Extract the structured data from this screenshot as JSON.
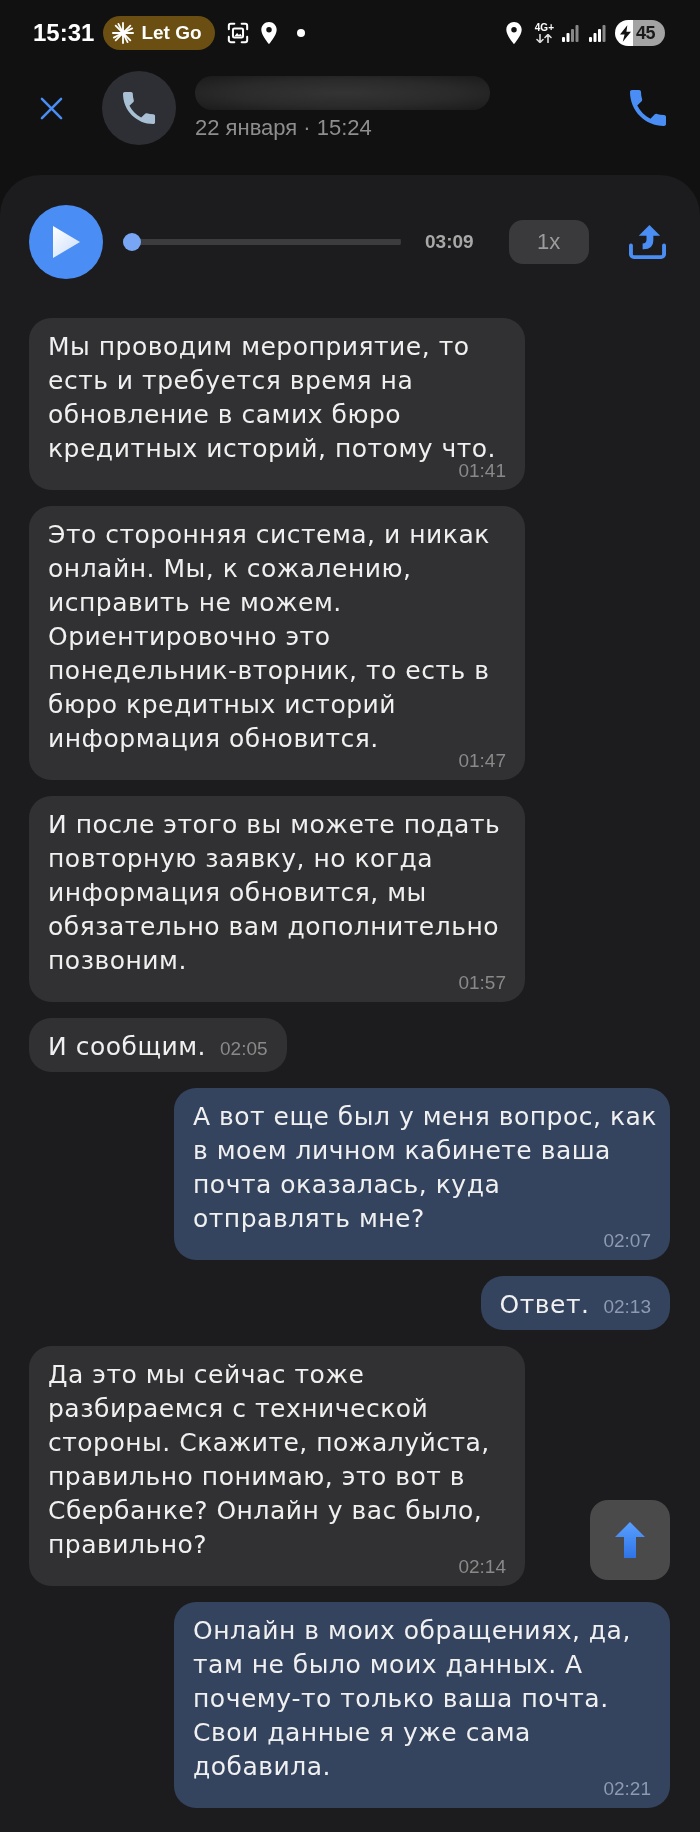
{
  "status_bar": {
    "time": "15:31",
    "chip": {
      "label": "Let Go"
    },
    "network": "4G+",
    "battery": "45"
  },
  "header": {
    "date": "22 января · 15:24"
  },
  "player": {
    "playing": false,
    "level": 0,
    "duration": "03:09",
    "speed": "1x"
  },
  "messages": [
    {
      "kind": "incoming",
      "text": "Мы проводим мероприятие, то есть и требуется время на обновление в самих бюро кредитных историй, потому что.",
      "time": "01:41"
    },
    {
      "kind": "incoming",
      "text": "Это сторонняя система, и никак онлайн. Мы, к сожалению, исправить не можем. Ориентировочно это понедельник-вторник, то есть в бюро кредитных историй информация обновится.",
      "time": "01:47"
    },
    {
      "kind": "incoming",
      "text": "И после этого вы можете подать повторную заявку, но когда информация обновится, мы обязательно вам дополнительно позвоним.",
      "time": "01:57"
    },
    {
      "kind": "incoming",
      "text": "И сообщим.",
      "time": "02:05"
    },
    {
      "kind": "outgoing",
      "text": "А вот еще был у меня вопрос, как в моем личном кабинете ваша почта оказалась, куда отправлять мне?",
      "time": "02:07"
    },
    {
      "kind": "outgoing",
      "text": "Ответ.",
      "time": "02:13"
    },
    {
      "kind": "incoming",
      "text": "Да это мы сейчас тоже разбираемся с технической стороны. Скажите, пожалуйста, правильно понимаю, это вот в Сбербанке? Онлайн у вас было, правильно?",
      "time": "02:14"
    },
    {
      "kind": "outgoing",
      "text": "Онлайн в моих обращениях, да, там не было моих данных. А почему-то только ваша почта. Свои данные я уже сама добавила.",
      "time": "02:21"
    }
  ]
}
